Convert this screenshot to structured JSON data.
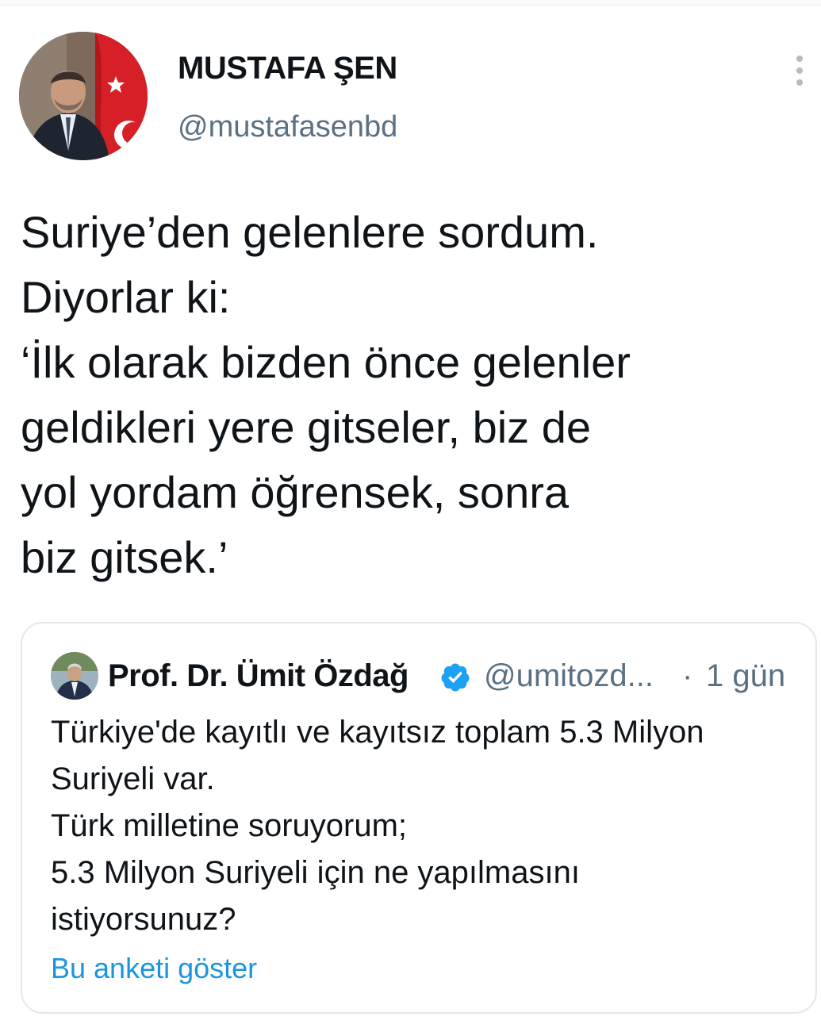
{
  "tweet": {
    "author": {
      "display_name": "MUSTAFA ŞEN",
      "handle": "@mustafasenbd",
      "avatar_icon": "profile-photo"
    },
    "more_icon": "vertical-ellipsis-icon",
    "text_lines": [
      "Suriye’den gelenlere sordum.",
      "Diyorlar ki:",
      "‘İlk olarak bizden önce gelenler",
      "geldikleri yere gitseler, biz de",
      "yol yordam öğrensek, sonra",
      "biz gitsek.’"
    ]
  },
  "quoted_tweet": {
    "author": {
      "display_name": "Prof. Dr. Ümit Özdağ",
      "verified_icon": "verified-badge-icon",
      "handle": "@umitozd...",
      "avatar_icon": "profile-photo"
    },
    "separator": "·",
    "time": "1 gün",
    "text_lines": [
      "Türkiye'de kayıtlı ve kayıtsız toplam 5.3 Milyon",
      "Suriyeli var.",
      "Türk milletine soruyorum;",
      "5.3 Milyon Suriyeli için ne yapılmasını",
      "istiyorsunuz?"
    ],
    "poll_link": "Bu anketi göster"
  },
  "colors": {
    "text_primary": "#0f1419",
    "text_secondary": "#5b7083",
    "link": "#1b95e0",
    "verified": "#1da1f2",
    "border": "#e1e8ed"
  }
}
